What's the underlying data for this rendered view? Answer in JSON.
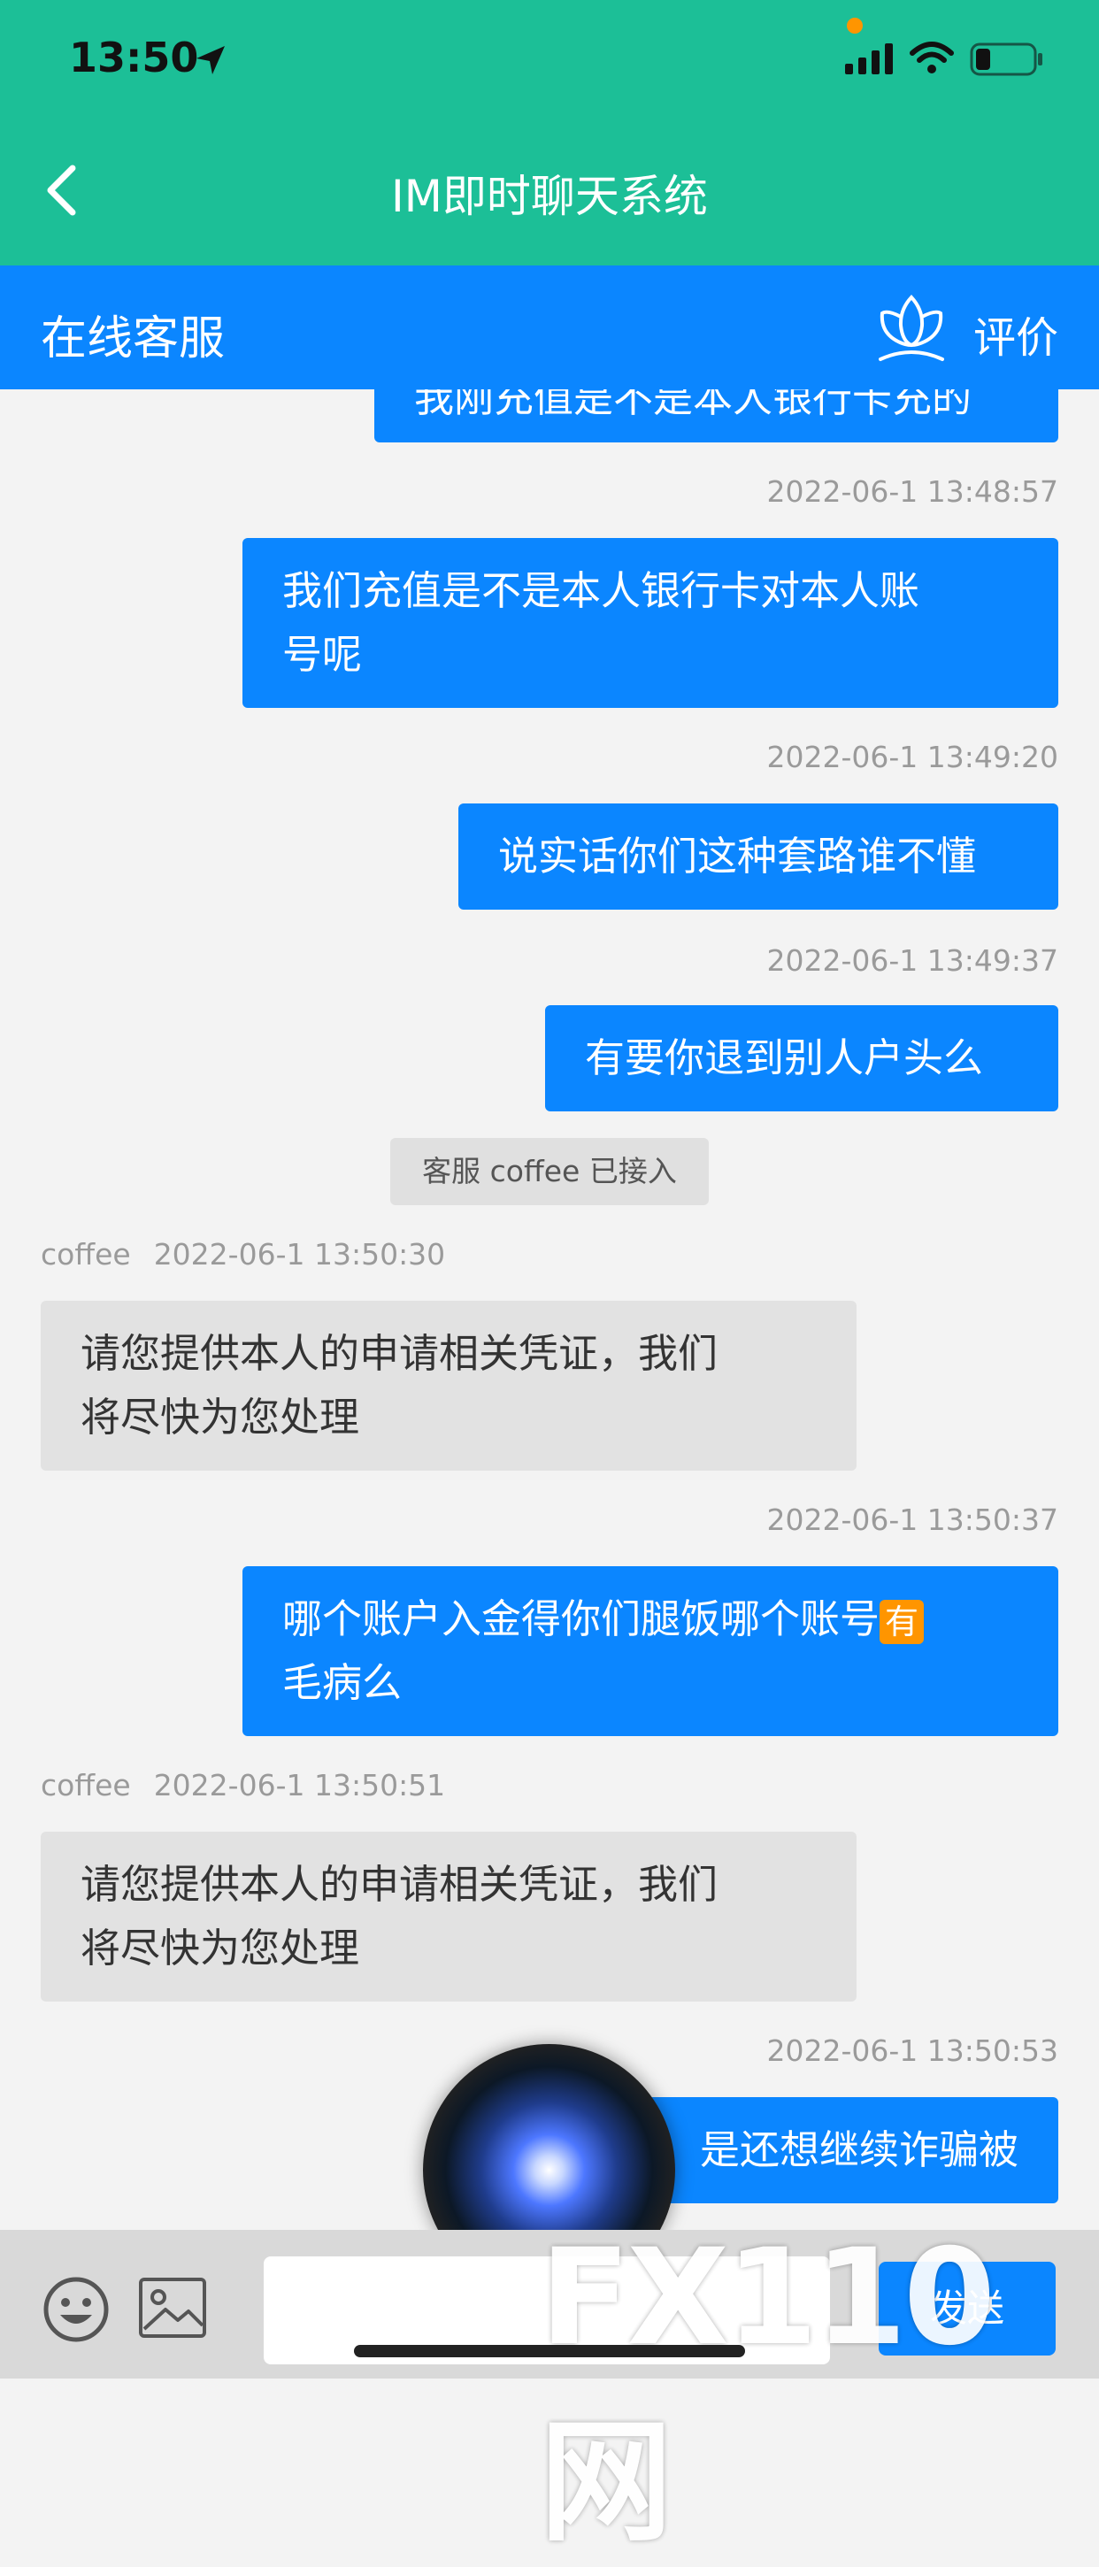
{
  "status": {
    "time": "13:50"
  },
  "nav": {
    "title": "IM即时聊天系统"
  },
  "cs_bar": {
    "title": "在线客服",
    "rate_label": "评价"
  },
  "chat": {
    "m0_text": "我刚充值是不是本人银行卡充的",
    "t1": "2022-06-1 13:48:57",
    "m1_line1": "我们充值是不是本人银行卡对本人账",
    "m1_line2": "号呢",
    "t2": "2022-06-1 13:49:20",
    "m2_text": "说实话你们这种套路谁不懂",
    "t3": "2022-06-1 13:49:37",
    "m3_text": "有要你退到别人户头么",
    "sys": "客服 coffee 已接入",
    "a1_name": "coffee",
    "a1_time": "2022-06-1 13:50:30",
    "a1_line1": "请您提供本人的申请相关凭证，我们",
    "a1_line2": "将尽快为您处理",
    "t4": "2022-06-1 13:50:37",
    "m4_line1": "哪个账户入金得你们腿饭哪个账号",
    "m4_emoji": "有",
    "m4_line2": "毛病么",
    "a2_name": "coffee",
    "a2_time": "2022-06-1 13:50:51",
    "a2_line1": "请您提供本人的申请相关凭证，我们",
    "a2_line2": "将尽快为您处理",
    "t5": "2022-06-1 13:50:53",
    "m5_text": "是还想继续诈骗被"
  },
  "input": {
    "placeholder": "",
    "send_label": "发送"
  },
  "watermark": {
    "text": "FX110网"
  },
  "colors": {
    "header": "#1cbf97",
    "cs_bar": "#0b86ff",
    "outgoing": "#0b86ff",
    "incoming": "#e2e2e2"
  }
}
